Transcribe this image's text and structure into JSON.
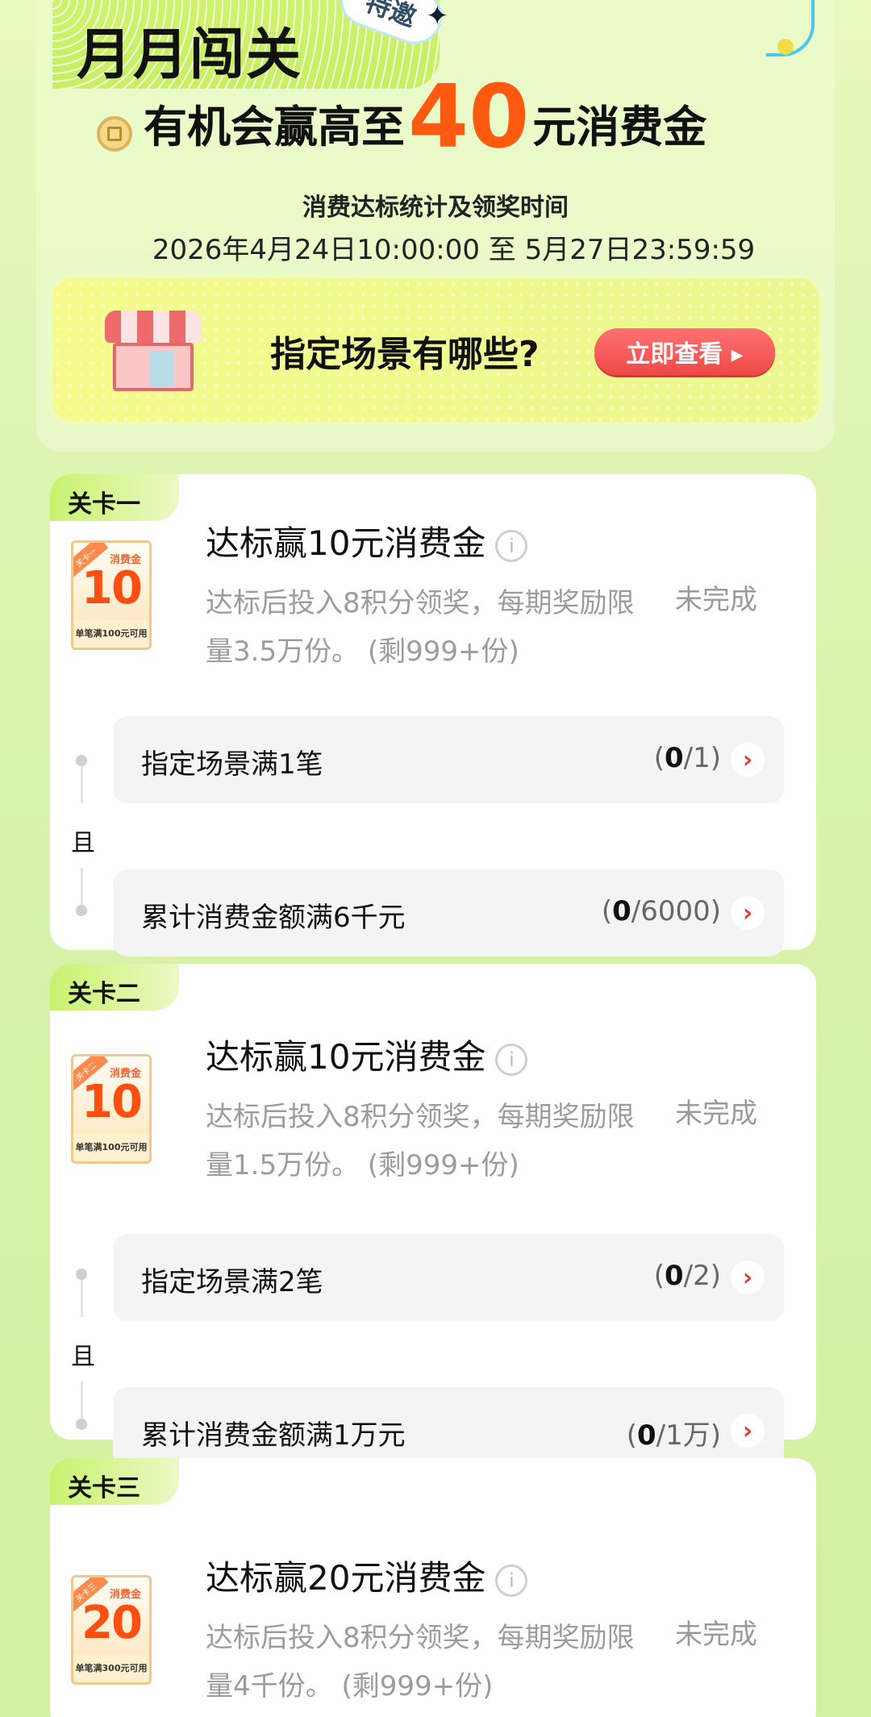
{
  "header": {
    "title": "月月闯关",
    "invite_badge": "特邀",
    "subtitle_prefix": "有机会赢高至",
    "subtitle_amount": "40",
    "subtitle_suffix": "元消费金",
    "period_label": "消费达标统计及领奖时间",
    "period_text": "2026年4月24日10:00:00 至 5月27日23:59:59"
  },
  "banner": {
    "text": "指定场景有哪些?",
    "button_label": "立即查看 ▸"
  },
  "levels": [
    {
      "tab": "关卡一",
      "voucher_label": "消费金",
      "voucher_amount": "10",
      "voucher_condition": "单笔满100元可用",
      "title": "达标赢10元消费金",
      "desc": "达标后投入8积分领奖，每期奖励限量3.5万份。 (剩999+份)",
      "status": "未完成",
      "tasks": [
        {
          "label": "指定场景满1笔",
          "done": "0",
          "total": "/1)"
        },
        {
          "label": "累计消费金额满6千元",
          "done": "0",
          "total": "/6000)"
        }
      ],
      "connector": "且"
    },
    {
      "tab": "关卡二",
      "voucher_label": "消费金",
      "voucher_amount": "10",
      "voucher_condition": "单笔满100元可用",
      "title": "达标赢10元消费金",
      "desc": "达标后投入8积分领奖，每期奖励限量1.5万份。 (剩999+份)",
      "status": "未完成",
      "tasks": [
        {
          "label": "指定场景满2笔",
          "done": "0",
          "total": "/2)"
        },
        {
          "label": "累计消费金额满1万元",
          "done": "0",
          "total": "/1万)"
        }
      ],
      "connector": "且"
    },
    {
      "tab": "关卡三",
      "voucher_label": "消费金",
      "voucher_amount": "20",
      "voucher_condition": "单笔满300元可用",
      "title": "达标赢20元消费金",
      "desc": "达标后投入8积分领奖，每期奖励限量4千份。 (剩999+份)",
      "status": "未完成"
    }
  ],
  "icons": {
    "info": "info-icon",
    "chevron": "chevron-right-icon",
    "coin": "coin-icon",
    "shop": "shop-icon"
  }
}
